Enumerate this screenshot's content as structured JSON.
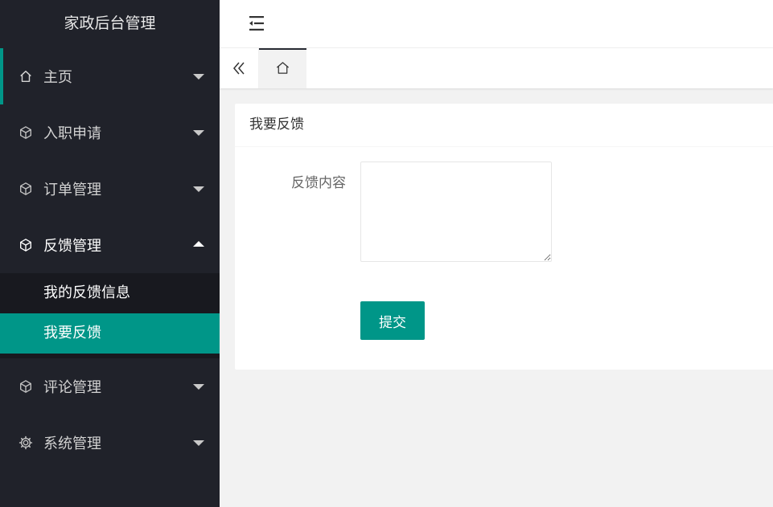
{
  "app": {
    "title": "家政后台管理"
  },
  "sidebar": {
    "items": [
      {
        "label": "主页",
        "icon": "home-icon"
      },
      {
        "label": "入职申请",
        "icon": "cube-icon"
      },
      {
        "label": "订单管理",
        "icon": "cube-icon"
      },
      {
        "label": "反馈管理",
        "icon": "cube-icon",
        "expanded": true,
        "children": [
          {
            "label": "我的反馈信息"
          },
          {
            "label": "我要反馈",
            "selected": true
          }
        ]
      },
      {
        "label": "评论管理",
        "icon": "cube-icon"
      },
      {
        "label": "系统管理",
        "icon": "gear-icon"
      }
    ]
  },
  "tabs": {
    "home_icon": "home-icon"
  },
  "card": {
    "title": "我要反馈",
    "field_label": "反馈内容",
    "field_value": "",
    "submit_label": "提交"
  },
  "colors": {
    "sidebar_bg": "#20222a",
    "accent": "#009688",
    "page_bg": "#f2f2f2"
  }
}
